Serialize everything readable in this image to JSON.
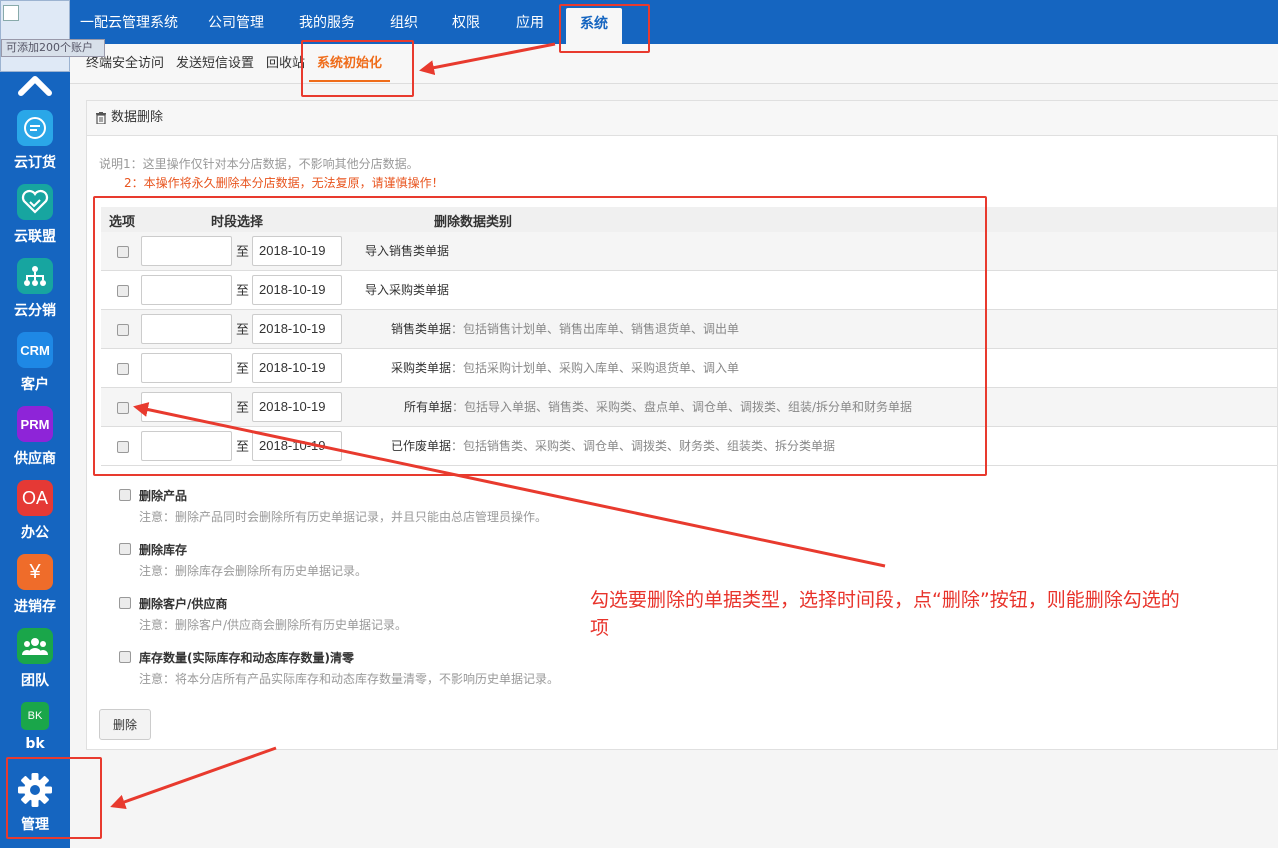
{
  "sidebar": {
    "account_tip": "可添加200个账户",
    "items": [
      {
        "label": "云订货",
        "icon": "chat-bubble-icon",
        "color": "#2aa7e8"
      },
      {
        "label": "云联盟",
        "icon": "handshake-heart-icon",
        "color": "#17a5a0"
      },
      {
        "label": "云分销",
        "icon": "org-tree-icon",
        "color": "#17a5a0"
      },
      {
        "label": "客户",
        "icon_text": "CRM",
        "color": "#1e88e5"
      },
      {
        "label": "供应商",
        "icon_text": "PRM",
        "color": "#8e24d8"
      },
      {
        "label": "办公",
        "icon_text": "OA",
        "color": "#e53935"
      },
      {
        "label": "进销存",
        "icon_text": "¥",
        "color": "#ef6c2a"
      },
      {
        "label": "团队",
        "icon": "team-icon",
        "color": "#1aa64a"
      },
      {
        "label": "bk",
        "icon_text": "BK",
        "color": "#1aa64a"
      },
      {
        "label": "管理",
        "icon": "gear-icon",
        "color": "#1565c0"
      }
    ]
  },
  "topnav": {
    "items": [
      "一配云管理系统",
      "公司管理",
      "我的服务",
      "组织",
      "权限",
      "应用",
      "系统"
    ],
    "active": "系统"
  },
  "subnav": {
    "items": [
      "终端安全访问",
      "发送短信设置",
      "回收站",
      "系统初始化"
    ],
    "active": "系统初始化"
  },
  "panel": {
    "title": "数据删除",
    "note1": "说明1：这里操作仅针对本分店数据，不影响其他分店数据。",
    "note2": "2：本操作将永久删除本分店数据，无法复原，请谨慎操作！"
  },
  "table": {
    "headers": {
      "option": "选项",
      "period": "时段选择",
      "category": "删除数据类别"
    },
    "to_label": "至",
    "rows": [
      {
        "date_from": "",
        "date_to": "2018-10-19",
        "category": "导入销售类单据",
        "desc": ""
      },
      {
        "date_from": "",
        "date_to": "2018-10-19",
        "category": "导入采购类单据",
        "desc": ""
      },
      {
        "date_from": "",
        "date_to": "2018-10-19",
        "category": "销售类单据",
        "desc": "：包括销售计划单、销售出库单、销售退货单、调出单"
      },
      {
        "date_from": "",
        "date_to": "2018-10-19",
        "category": "采购类单据",
        "desc": "：包括采购计划单、采购入库单、采购退货单、调入单"
      },
      {
        "date_from": "",
        "date_to": "2018-10-19",
        "category": "所有单据",
        "desc": "：包括导入单据、销售类、采购类、盘点单、调仓单、调拨类、组装/拆分单和财务单据"
      },
      {
        "date_from": "",
        "date_to": "2018-10-19",
        "category": "已作废单据",
        "desc": "：包括销售类、采购类、调仓单、调拨类、财务类、组装类、拆分类单据"
      }
    ]
  },
  "options": [
    {
      "title": "删除产品",
      "note": "注意：删除产品同时会删除所有历史单据记录，并且只能由总店管理员操作。"
    },
    {
      "title": "删除库存",
      "note": "注意：删除库存会删除所有历史单据记录。"
    },
    {
      "title": "删除客户/供应商",
      "note": "注意：删除客户/供应商会删除所有历史单据记录。"
    },
    {
      "title": "库存数量(实际库存和动态库存数量)清零",
      "note": "注意：将本分店所有产品实际库存和动态库存数量清零，不影响历史单据记录。"
    }
  ],
  "delete_button": "删除",
  "annotation": {
    "text": "勾选要删除的单据类型，选择时间段，点“删除”按钮，则能删除勾选的项",
    "color": "#e8332b"
  }
}
